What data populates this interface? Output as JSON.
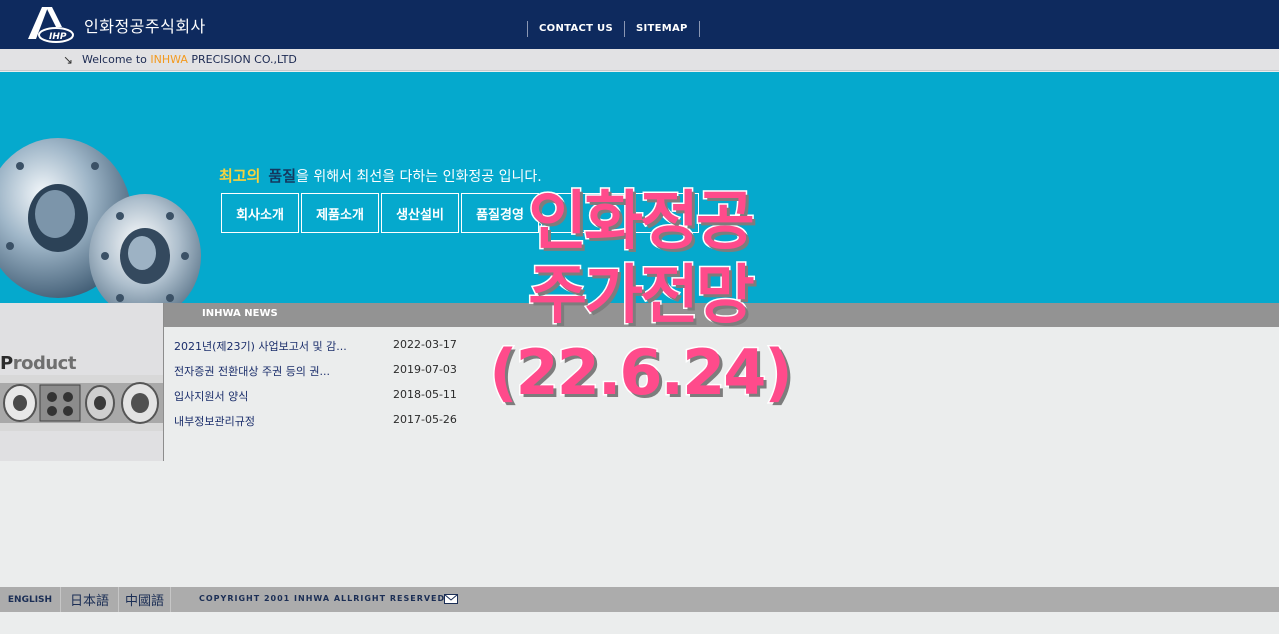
{
  "header": {
    "company_name": "인화정공주식회사",
    "logo_text": "IHP",
    "nav": [
      "CONTACT US",
      "SITEMAP"
    ]
  },
  "welcome": {
    "prefix": "Welcome to ",
    "highlight": "INHWA",
    "suffix": " PRECISION CO.,LTD"
  },
  "banner": {
    "slogan_1": "최고의",
    "slogan_2": "품질",
    "slogan_rest": "을 위해서 최선을 다하는 인화정공 입니다.",
    "menu": [
      "회사소개",
      "제품소개",
      "생산설비",
      "품질경영",
      "",
      ""
    ]
  },
  "product": {
    "label_first": "P",
    "label_rest": "roduct"
  },
  "news": {
    "title": "INHWA NEWS",
    "items": [
      {
        "title": "2021년(제23기) 사업보고서 및 감...",
        "date": "2022-03-17"
      },
      {
        "title": "전자증권 전환대상 주권 등의 권...",
        "date": "2019-07-03"
      },
      {
        "title": "입사지원서 양식",
        "date": "2018-05-11"
      },
      {
        "title": "내부정보관리규정",
        "date": "2017-05-26"
      }
    ]
  },
  "overlay": {
    "line1": "인화정공",
    "line2": "주가전망",
    "line3": "(22.6.24)"
  },
  "footer": {
    "langs": [
      "ENGLISH",
      "日本語",
      "中國語"
    ],
    "copyright": "COPYRIGHT 2001 INHWA ALLRIGHT RESERVED"
  },
  "colors": {
    "header_bg": "#0e2a5e",
    "banner_bg": "#05a9cd",
    "overlay_pink": "#ff4b8b",
    "accent_orange": "#f39a1f"
  }
}
